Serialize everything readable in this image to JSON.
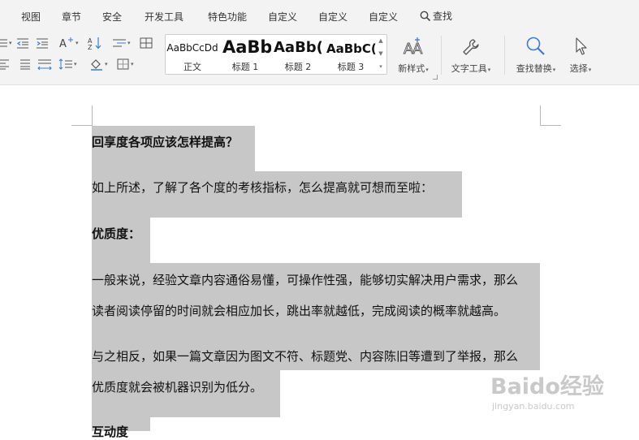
{
  "menubar": {
    "items": [
      "视图",
      "章节",
      "安全",
      "开发工具",
      "特色功能",
      "自定义",
      "自定义",
      "自定义"
    ],
    "search_label": "查找"
  },
  "styles": [
    {
      "preview": "AaBbCcDd",
      "name": "正文"
    },
    {
      "preview": "AaBb",
      "name": "标题 1"
    },
    {
      "preview": "AaBb(",
      "name": "标题 2"
    },
    {
      "preview": "AaBbC(",
      "name": "标题 3"
    }
  ],
  "tools": {
    "new_style": "新样式",
    "text_tools": "文字工具",
    "find_replace": "查找替换",
    "select": "选择"
  },
  "document": {
    "lines": [
      "回享度各项应该怎样提高？",
      "如上所述，了解了各个度的考核指标，怎么提高就可想而至啦：",
      "优质度：",
      "一般来说，经验文章内容通俗易懂，可操作性强，能够切实解决用户需求，那么",
      "读者阅读停留的时间就会相应加长，跳出率就越低，完成阅读的概率就越高。",
      "与之相反，如果一篇文章因为图文不符、标题党、内容陈旧等遭到了举报，那么",
      "优质度就会被机器识别为低分。",
      "互动度"
    ]
  },
  "watermark": {
    "main": "Baido经验",
    "sub": "jingyan.baidu.com"
  },
  "colors": {
    "ribbon_bg": "#f3f3f3",
    "selection": "#c7c7c7",
    "accent_blue": "#3a7bd5"
  }
}
